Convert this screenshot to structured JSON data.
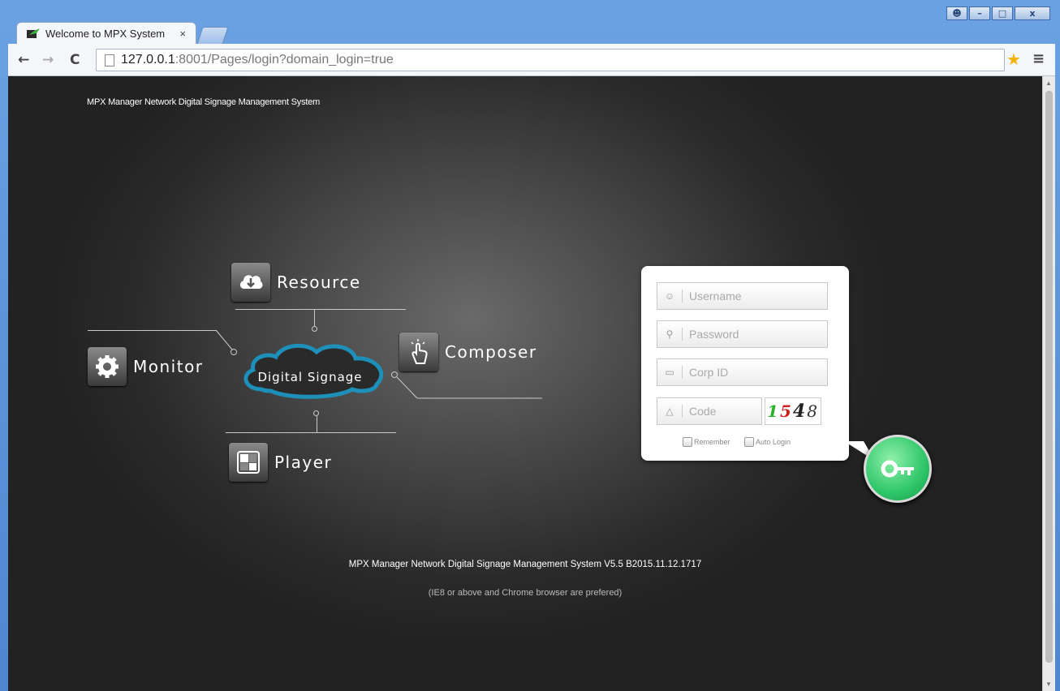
{
  "browser": {
    "tab_title": "Welcome to MPX System",
    "tab_close": "×",
    "url_host": "127.0.0.1",
    "url_path": ":8001/Pages/login?domain_login=true",
    "window_controls": [
      "user-icon",
      "minimize-icon",
      "maximize-icon",
      "close-icon"
    ]
  },
  "page": {
    "system_title": "MPX Manager Network Digital Signage Management System",
    "modules": {
      "resource": "Resource",
      "monitor": "Monitor",
      "composer": "Composer",
      "player": "Player"
    },
    "center_label": "Digital Signage",
    "footer_title": "MPX Manager Network Digital Signage Management System V5.5 B2015.11.12.1717",
    "footer_note": "(IE8 or above and Chrome browser are prefered)"
  },
  "login": {
    "username_placeholder": "Username",
    "password_placeholder": "Password",
    "corp_placeholder": "Corp ID",
    "code_placeholder": "Code",
    "captcha_digits": [
      {
        "d": "1",
        "color": "#2bb02b"
      },
      {
        "d": "5",
        "color": "#d21f1f"
      },
      {
        "d": "4",
        "color": "#222222"
      },
      {
        "d": "8",
        "color": "#333333"
      }
    ],
    "remember_label": "Remember",
    "auto_login_label": "Auto Login"
  },
  "colors": {
    "cloud_stroke": "#1d8fb8",
    "login_button": "#2fc66a"
  }
}
